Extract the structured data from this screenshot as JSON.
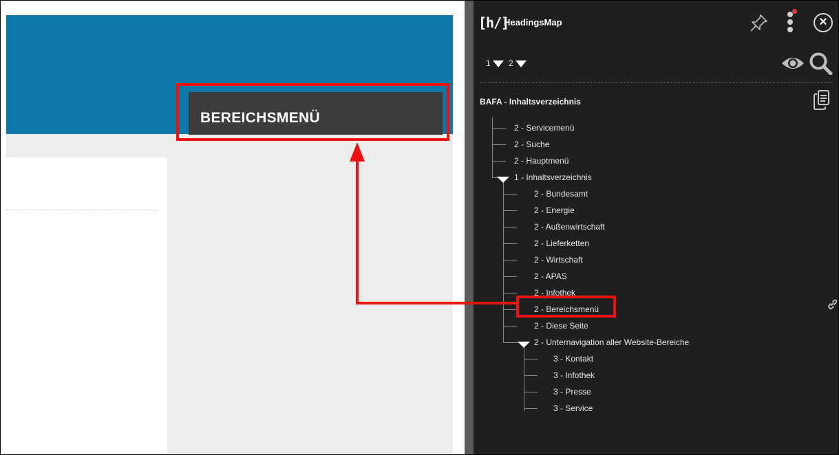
{
  "site": {
    "section_label": "BEREICHSMENÜ"
  },
  "panel": {
    "logo": "[h/]",
    "title": "HeadingsMap",
    "level_selectors": [
      "1",
      "2"
    ],
    "document_title": "BAFA - Inhaltsverzeichnis",
    "icons": {
      "pin": "pin-icon",
      "menu": "kebab-menu-icon",
      "close": "close-icon",
      "eye": "eye-icon",
      "search": "search-icon",
      "copy": "copy-icon",
      "link": "link-icon"
    },
    "tree": [
      {
        "text": "2 - Servicemenü"
      },
      {
        "text": "2 - Suche"
      },
      {
        "text": "2 - Hauptmenü"
      },
      {
        "text": "1 - Inhaltsverzeichnis"
      },
      {
        "text": "2 - Bundesamt"
      },
      {
        "text": "2 - Energie"
      },
      {
        "text": "2 - Außenwirtschaft"
      },
      {
        "text": "2 - Lieferketten"
      },
      {
        "text": "2 - Wirtschaft"
      },
      {
        "text": "2 - APAS"
      },
      {
        "text": "2 - Infothek"
      },
      {
        "text": "2 - Bereichsmenü"
      },
      {
        "text": "2 - Diese Seite"
      },
      {
        "text": "2 - Unternavigation aller Website-Bereiche"
      },
      {
        "text": "3 - Kontakt"
      },
      {
        "text": "3 - Infothek"
      },
      {
        "text": "3 - Presse"
      },
      {
        "text": "3 - Service"
      }
    ]
  },
  "colors": {
    "site_header": "#0e78a8",
    "annotation_red": "#ee1111",
    "panel_bg": "#1f1f1f"
  }
}
